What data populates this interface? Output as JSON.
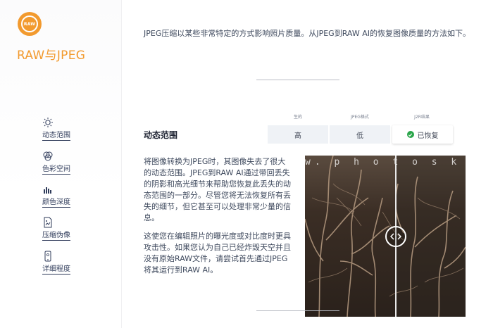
{
  "app": {
    "logo_text": "RAW",
    "title": "RAW与JPEG"
  },
  "sidebar": {
    "items": [
      {
        "label": "动态范围",
        "icon": "sun-icon"
      },
      {
        "label": "色彩空间",
        "icon": "color-circles-icon"
      },
      {
        "label": "颜色深度",
        "icon": "bars-icon"
      },
      {
        "label": "压缩伪像",
        "icon": "image-file-icon"
      },
      {
        "label": "详细程度",
        "icon": "phone-icon"
      }
    ]
  },
  "intro": "JPEG压缩以某些非常特定的方式影响照片质量。从JPEG到RAW AI的恢复图像质量的方法如下。",
  "comparison": {
    "columns": [
      "生的",
      "JPEG格式",
      "J2R结果"
    ],
    "row_title": "动态范围",
    "values": [
      "高",
      "低",
      "已恢复"
    ]
  },
  "body": [
    "将图像转换为JPEG时，其图像失去了很大的动态范围。JPEG到RAW AI通过带回丢失的阴影和高光细节来帮助您恢复此丢失的动态范围的一部分。尽管您将无法恢复所有丢失的细节，但它甚至可以处理非常少量的信息。",
    "这使您在编辑照片的曝光度或对比度时更具攻击性。如果您认为自己已经炸毁天空并且没有原始RAW文件，请尝试首先通过JPEG将其运行到RAW AI。"
  ],
  "photo": {
    "watermark": "w. p h o t o s k s . v i"
  },
  "colors": {
    "accent": "#f29a2e",
    "nav_text": "#2f3b5a",
    "success": "#2aa54a"
  }
}
